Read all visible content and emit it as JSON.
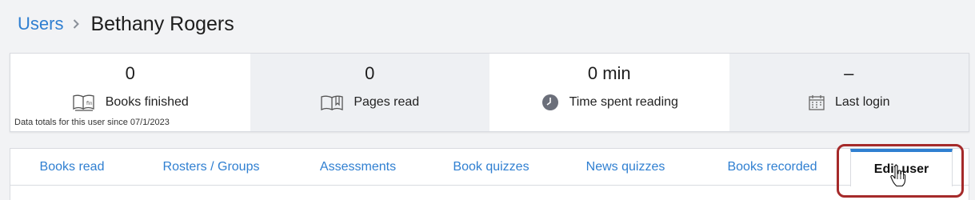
{
  "breadcrumb": {
    "parent_label": "Users",
    "current_label": "Bethany Rogers"
  },
  "stats": [
    {
      "value": "0",
      "label": "Books finished",
      "icon": "book-icon"
    },
    {
      "value": "0",
      "label": "Pages read",
      "icon": "open-book-icon"
    },
    {
      "value": "0 min",
      "label": "Time spent reading",
      "icon": "clock-icon"
    },
    {
      "value": "–",
      "label": "Last login",
      "icon": "calendar-icon"
    }
  ],
  "stats_note": "Data totals for this user since 07/1/2023",
  "tabs": [
    {
      "label": "Books read"
    },
    {
      "label": "Rosters / Groups"
    },
    {
      "label": "Assessments"
    },
    {
      "label": "Book quizzes"
    },
    {
      "label": "News quizzes"
    },
    {
      "label": "Books recorded"
    },
    {
      "label": "Edit user",
      "active": true
    }
  ],
  "colors": {
    "accent": "#2f7fd1",
    "highlight": "#a52a2a"
  }
}
